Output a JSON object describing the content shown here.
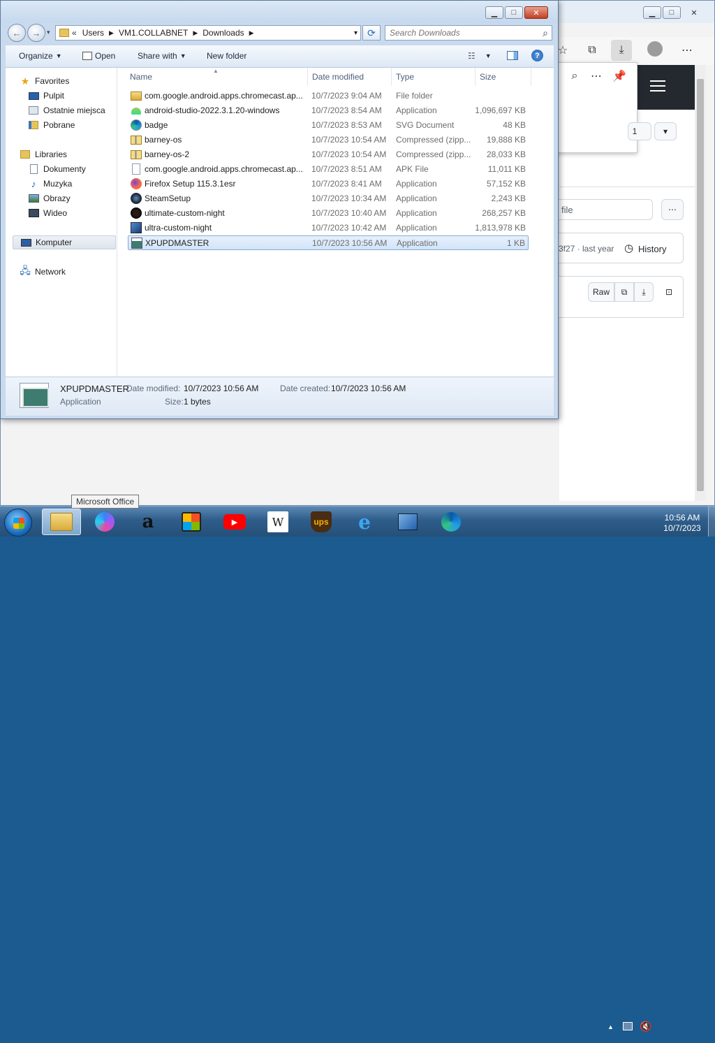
{
  "explorer": {
    "breadcrumb": {
      "overflow": "«",
      "parts": [
        "Users",
        "VM1.COLLABNET",
        "Downloads"
      ]
    },
    "search": {
      "placeholder": "Search Downloads"
    },
    "commands": {
      "organize": "Organize",
      "open": "Open",
      "share_with": "Share with",
      "new_folder": "New folder"
    },
    "nav": {
      "favorites": "Favorites",
      "fav_items": [
        "Pulpit",
        "Ostatnie miejsca",
        "Pobrane"
      ],
      "libraries": "Libraries",
      "lib_items": [
        "Dokumenty",
        "Muzyka",
        "Obrazy",
        "Wideo"
      ],
      "computer": "Komputer",
      "network": "Network"
    },
    "columns": {
      "name": "Name",
      "date": "Date modified",
      "type": "Type",
      "size": "Size"
    },
    "files": [
      {
        "name": "com.google.android.apps.chromecast.ap...",
        "date": "10/7/2023 9:04 AM",
        "type": "File folder",
        "size": "",
        "icon": "folder-icon"
      },
      {
        "name": "android-studio-2022.3.1.20-windows",
        "date": "10/7/2023 8:54 AM",
        "type": "Application",
        "size": "1,096,697 KB",
        "icon": "android-studio-icon"
      },
      {
        "name": "badge",
        "date": "10/7/2023 8:53 AM",
        "type": "SVG Document",
        "size": "48 KB",
        "icon": "edge-svg-icon"
      },
      {
        "name": "barney-os",
        "date": "10/7/2023 10:54 AM",
        "type": "Compressed (zipp...",
        "size": "19,888 KB",
        "icon": "zip-folder-icon"
      },
      {
        "name": "barney-os-2",
        "date": "10/7/2023 10:54 AM",
        "type": "Compressed (zipp...",
        "size": "28,033 KB",
        "icon": "zip-folder-icon"
      },
      {
        "name": "com.google.android.apps.chromecast.ap...",
        "date": "10/7/2023 8:51 AM",
        "type": "APK File",
        "size": "11,011 KB",
        "icon": "blank-file-icon"
      },
      {
        "name": "Firefox Setup 115.3.1esr",
        "date": "10/7/2023 8:41 AM",
        "type": "Application",
        "size": "57,152 KB",
        "icon": "firefox-icon"
      },
      {
        "name": "SteamSetup",
        "date": "10/7/2023 10:34 AM",
        "type": "Application",
        "size": "2,243 KB",
        "icon": "steam-icon"
      },
      {
        "name": "ultimate-custom-night",
        "date": "10/7/2023 10:40 AM",
        "type": "Application",
        "size": "268,257 KB",
        "icon": "freddy-icon"
      },
      {
        "name": "ultra-custom-night",
        "date": "10/7/2023 10:42 AM",
        "type": "Application",
        "size": "1,813,978 KB",
        "icon": "app-icon"
      },
      {
        "name": "XPUPDMASTER",
        "date": "10/7/2023 10:56 AM",
        "type": "Application",
        "size": "1 KB",
        "icon": "exe-icon",
        "selected": true
      }
    ],
    "details": {
      "name": "XPUPDMASTER",
      "type": "Application",
      "modified_label": "Date modified:",
      "modified_value": "10/7/2023 10:56 AM",
      "created_label": "Date created:",
      "created_value": "10/7/2023 10:56 AM",
      "size_label": "Size:",
      "size_value": "1 bytes"
    }
  },
  "browser": {
    "file_placeholder": "file",
    "commit": "3f27 · last year",
    "history": "History",
    "raw": "Raw",
    "page_num": "1"
  },
  "taskbar": {
    "tooltip": "Microsoft Office",
    "apps": [
      "explorer",
      "copilot",
      "amazon",
      "shop",
      "youtube",
      "wikipedia",
      "ups",
      "internet-explorer",
      "notepad",
      "edge"
    ],
    "wiki_letter": "W",
    "ups_letters": "ups",
    "amazon_letter": "a",
    "clock_time": "10:56 AM",
    "clock_date": "10/7/2023"
  },
  "colors": {
    "accent": "#3a76bd",
    "selection": "#d2e4f8"
  }
}
